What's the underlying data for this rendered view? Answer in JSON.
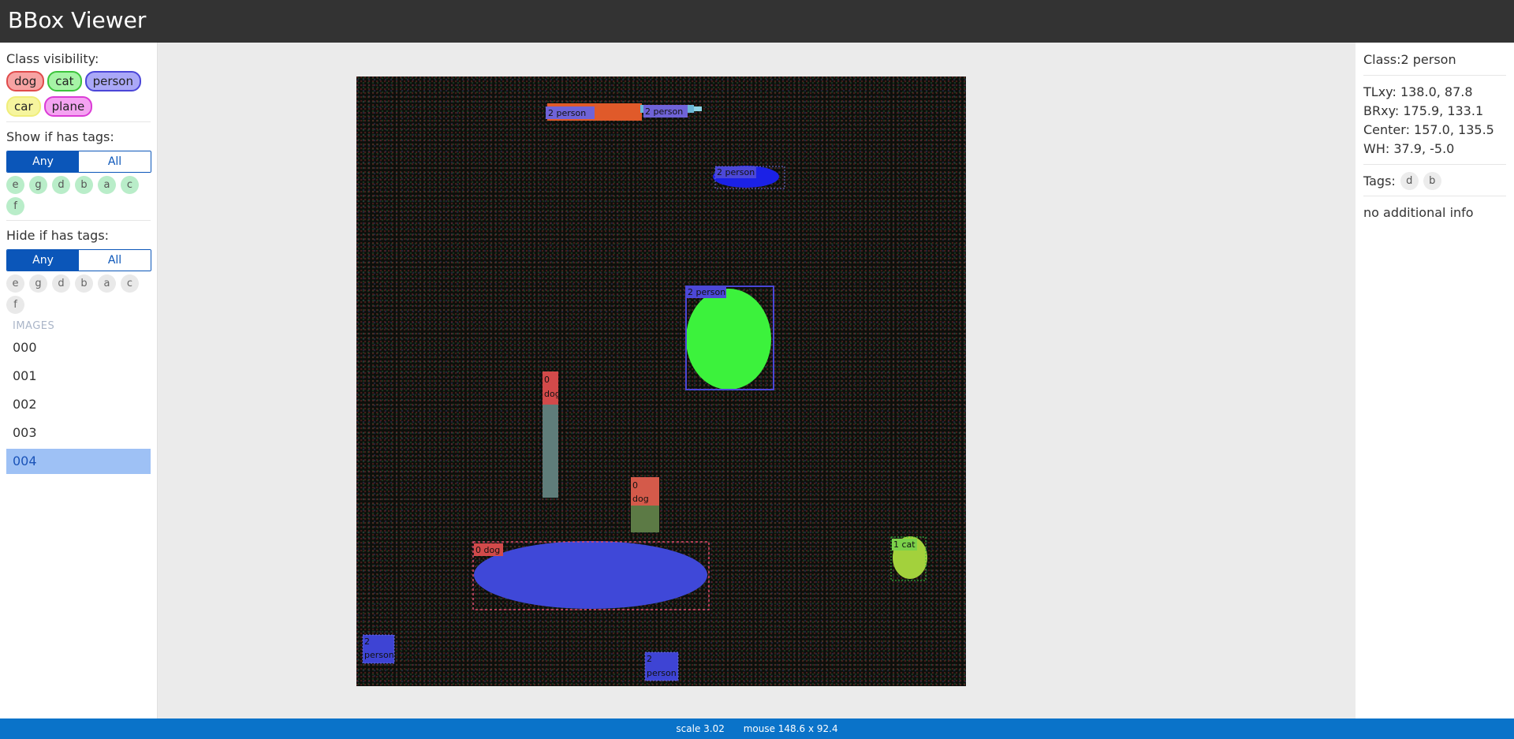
{
  "app": {
    "title": "BBox Viewer"
  },
  "sidebar": {
    "class_visibility_label": "Class visibility:",
    "classes": [
      {
        "name": "dog",
        "bg": "#f7a3a3",
        "border": "#e04b4b"
      },
      {
        "name": "cat",
        "bg": "#a6f4a6",
        "border": "#3cc43c"
      },
      {
        "name": "person",
        "bg": "#aaa8f7",
        "border": "#4b46d8"
      },
      {
        "name": "car",
        "bg": "#f6f59e",
        "border": "#f0ee7a"
      },
      {
        "name": "plane",
        "bg": "#f4a3f1",
        "border": "#db3cd6"
      }
    ],
    "show_if_label": "Show if has tags:",
    "show_toggle": {
      "any": "Any",
      "all": "All"
    },
    "show_tags": [
      "e",
      "g",
      "d",
      "b",
      "a",
      "c",
      "f"
    ],
    "hide_if_label": "Hide if has tags:",
    "hide_toggle": {
      "any": "Any",
      "all": "All"
    },
    "hide_tags": [
      "e",
      "g",
      "d",
      "b",
      "a",
      "c",
      "f"
    ],
    "images_label": "IMAGES",
    "images": [
      "000",
      "001",
      "002",
      "003",
      "004"
    ],
    "selected_image": "004"
  },
  "canvas": {
    "labels": {
      "person_top_left": "2 person",
      "person_top_right": "2 person",
      "person_blue_small": "2 person",
      "person_green_box": "2 person",
      "dog_vertical_a": "0",
      "dog_vertical_b": "dog",
      "dog_mid_a": "0",
      "dog_mid_b": "dog",
      "dog_ellipse": "0 dog",
      "cat": "1 cat",
      "person_bl_a": "2",
      "person_bl_b": "person",
      "person_bc_a": "2",
      "person_bc_b": "person"
    }
  },
  "details": {
    "class_line": "Class:2  person",
    "tlxy": "TLxy: 138.0, 87.8",
    "brxy": "BRxy: 175.9, 133.1",
    "center": "Center: 157.0, 135.5",
    "wh": "WH: 37.9, -5.0",
    "tags_label": "Tags:",
    "tags": [
      "d",
      "b"
    ],
    "info": "no additional info"
  },
  "status": {
    "scale": "scale 3.02",
    "mouse": "mouse 148.6 x 92.4"
  },
  "colors": {
    "header_bg": "#333333",
    "toggle_active": "#0b56b9",
    "status_bg": "#0a73c9",
    "selected_item_bg": "#9ec1f5"
  }
}
